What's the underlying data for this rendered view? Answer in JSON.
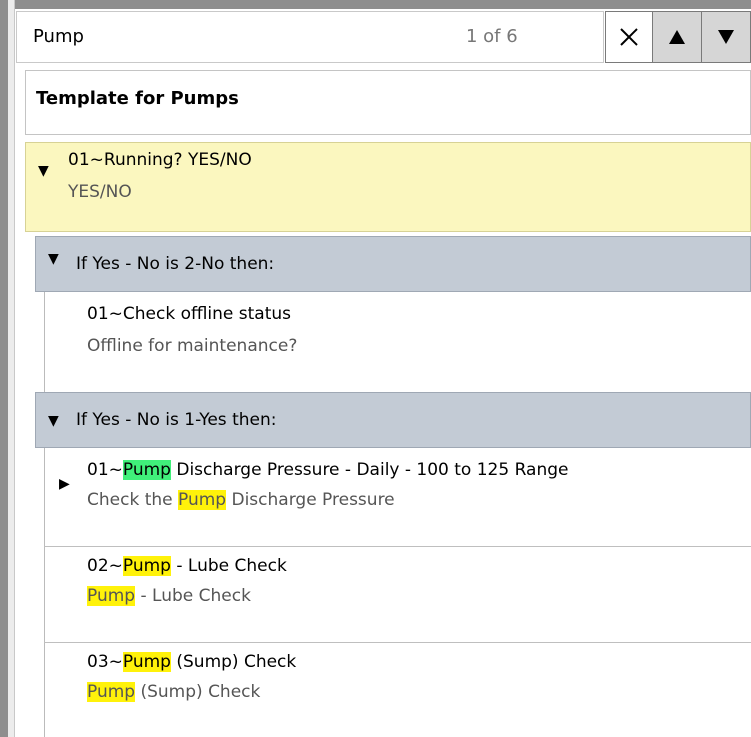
{
  "search": {
    "query": "Pump",
    "match_count": "1 of 6",
    "close_icon": "close-icon",
    "prev_icon": "arrow-up-icon",
    "next_icon": "arrow-down-icon"
  },
  "template": {
    "title": "Template for Pumps"
  },
  "question": {
    "prefix": "01~",
    "text": "Running? YES/NO",
    "answer_type": "YES/NO",
    "expanded": true
  },
  "branches": [
    {
      "header": "If Yes - No is 2-No then:",
      "expanded": true,
      "items": [
        {
          "title": "01~Check offline status",
          "subtitle": "Offline for maintenance?"
        }
      ]
    },
    {
      "header": "If Yes - No is 1-Yes then:",
      "expanded": true,
      "items": [
        {
          "title_pre": "01~",
          "title_hl": "Pump",
          "title_post": " Discharge Pressure - Daily - 100 to 125 Range",
          "sub_pre": "Check the ",
          "sub_hl": "Pump",
          "sub_post": " Discharge Pressure",
          "current_match": true,
          "collapsed": true
        },
        {
          "title_pre": "02~",
          "title_hl": "Pump",
          "title_post": " - Lube Check",
          "sub_pre": "",
          "sub_hl": "Pump",
          "sub_post": " - Lube Check"
        },
        {
          "title_pre": "03~",
          "title_hl": "Pump",
          "title_post": " (Sump) Check",
          "sub_pre": "",
          "sub_hl": "Pump",
          "sub_post": " (Sump) Check"
        }
      ]
    }
  ],
  "colors": {
    "question_bg": "#fbf7bf",
    "branch_bg": "#c3cbd5",
    "current_match": "#40f07a",
    "match": "#fff20a"
  }
}
